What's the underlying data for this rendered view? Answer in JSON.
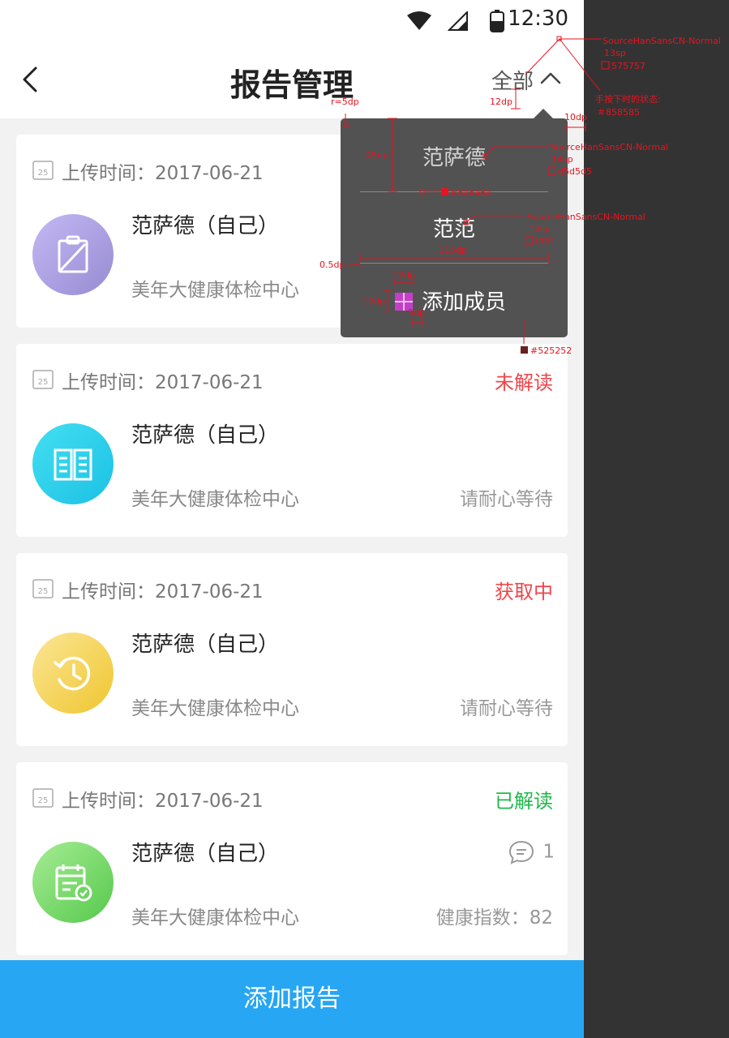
{
  "status_bar": {
    "time": "12:30"
  },
  "header": {
    "title": "报告管理",
    "filter_label": "全部"
  },
  "dropdown": {
    "items": [
      "范萨德",
      "范范"
    ],
    "add_member": "添加成员"
  },
  "cards": [
    {
      "upload_label": "上传时间：2017-06-21",
      "status": "",
      "status_color": "",
      "name": "范萨德（自己）",
      "org": "美年大健康体检中心",
      "right_meta": "",
      "comments": "",
      "avatar": "report-icon",
      "avatar_gradient": [
        "#b9aff0",
        "#9a8fd6"
      ]
    },
    {
      "upload_label": "上传时间：2017-06-21",
      "status": "未解读",
      "status_color": "#f0454b",
      "name": "范萨德（自己）",
      "org": "美年大健康体检中心",
      "right_meta": "请耐心等待",
      "comments": "",
      "avatar": "book-icon",
      "avatar_gradient": [
        "#3fdcf0",
        "#1dc4e6"
      ]
    },
    {
      "upload_label": "上传时间：2017-06-21",
      "status": "获取中",
      "status_color": "#f0454b",
      "name": "范萨德（自己）",
      "org": "美年大健康体检中心",
      "right_meta": "请耐心等待",
      "comments": "",
      "avatar": "clock-icon",
      "avatar_gradient": [
        "#fbe58a",
        "#f1c936"
      ]
    },
    {
      "upload_label": "上传时间：2017-06-21",
      "status": "已解读",
      "status_color": "#1fb84a",
      "name": "范萨德（自己）",
      "org": "美年大健康体检中心",
      "right_meta": "健康指数：82",
      "comments": "1",
      "avatar": "calendar-check-icon",
      "avatar_gradient": [
        "#9ee88a",
        "#5dcc55"
      ]
    }
  ],
  "footer": {
    "add_report": "添加报告"
  },
  "annotations": {
    "font_13": "SourceHanSansCN-Normal",
    "size_13": "13sp",
    "color_13": "575757",
    "pressed_state": "手按下时的状态:",
    "pressed_color": "＃858585",
    "radius": "r=5dp",
    "gap_12": "12dp",
    "gap_10": "10dp",
    "height_45": "45dp",
    "font_14a": "SourceHanSansCN-Normal",
    "size_14a": "14sp",
    "color_14a": "d5d5d5",
    "line_color": "#8a8a8a",
    "font_14b": "SourceHanSansCN-Normal",
    "size_14b": "14sp",
    "color_14b": "ffffff",
    "line_thick": "0.5dp",
    "width_115": "115dp",
    "icon_w": "12dp",
    "icon_h": "12dp",
    "icon_gap": "5dp",
    "bg_color": "#525252"
  },
  "colors": {
    "accent": "#26a6f3",
    "dropdown_bg": "#525252",
    "annotation_red": "#e8131f"
  }
}
